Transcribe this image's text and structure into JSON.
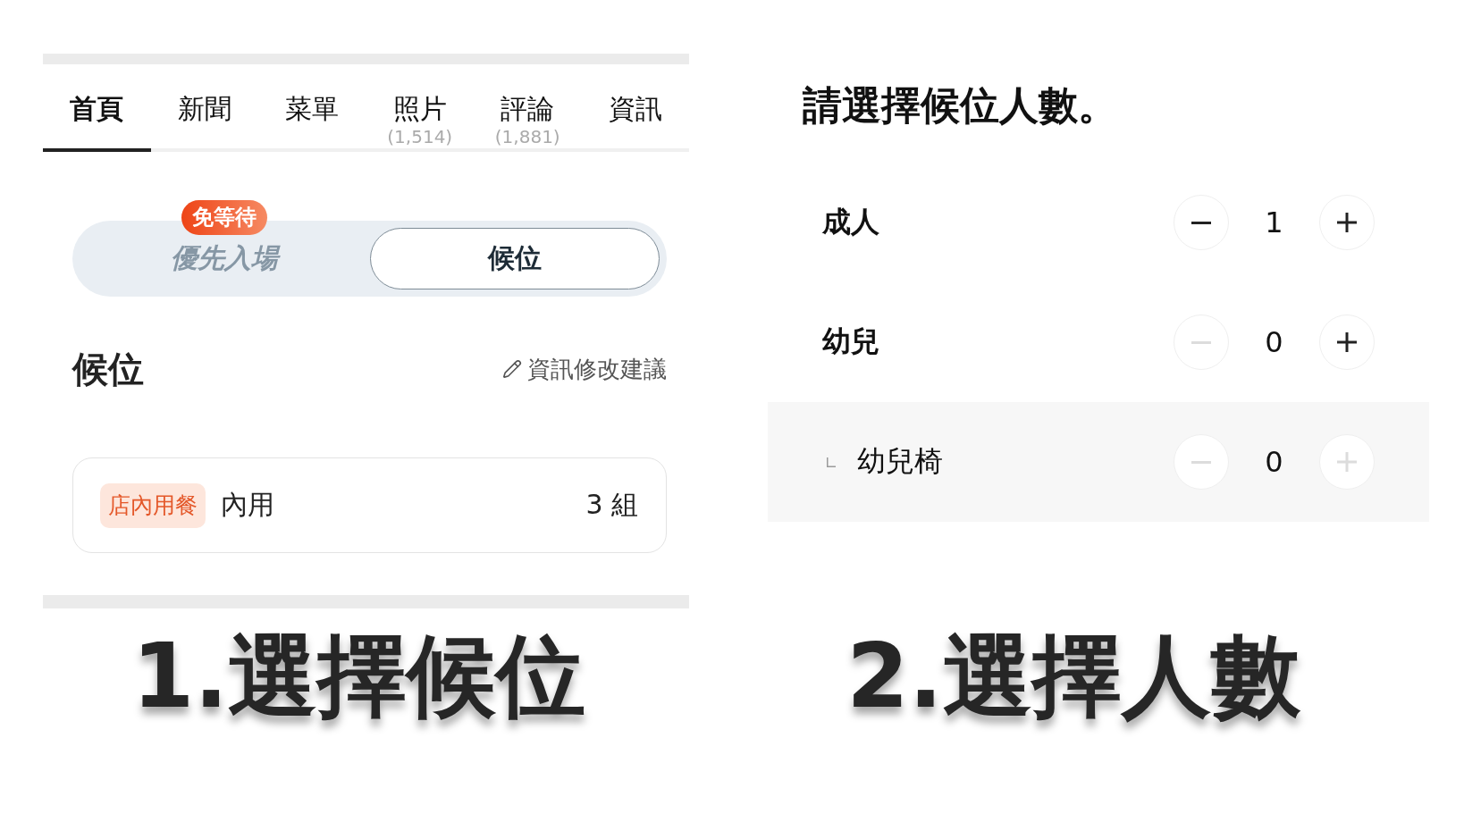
{
  "left_panel": {
    "tabs": [
      {
        "label": "首頁",
        "selected": true
      },
      {
        "label": "新聞",
        "selected": false
      },
      {
        "label": "菜單",
        "selected": false
      },
      {
        "label": "照片",
        "count": "(1,514)",
        "selected": false
      },
      {
        "label": "評論",
        "count": "(1,881)",
        "selected": false
      },
      {
        "label": "資訊",
        "selected": false
      }
    ],
    "mode_toggle": {
      "options": [
        {
          "label": "優先入場",
          "badge": "免等待",
          "selected": false
        },
        {
          "label": "候位",
          "selected": true
        }
      ]
    },
    "section": {
      "title": "候位",
      "edit_link": "資訊修改建議"
    },
    "queue_card": {
      "tag": "店內用餐",
      "label": "內用",
      "count": "3 組"
    }
  },
  "left_caption": "1.選擇候位",
  "right_panel": {
    "title": "請選擇候位人數。",
    "counters": [
      {
        "label": "成人",
        "value": "1",
        "minus_disabled": false,
        "plus_disabled": false
      },
      {
        "label": "幼兒",
        "value": "0",
        "minus_disabled": true,
        "plus_disabled": false,
        "children": [
          {
            "label": "幼兒椅",
            "value": "0",
            "minus_disabled": true,
            "plus_disabled": true
          }
        ]
      }
    ]
  },
  "right_caption": "2.選擇人數"
}
